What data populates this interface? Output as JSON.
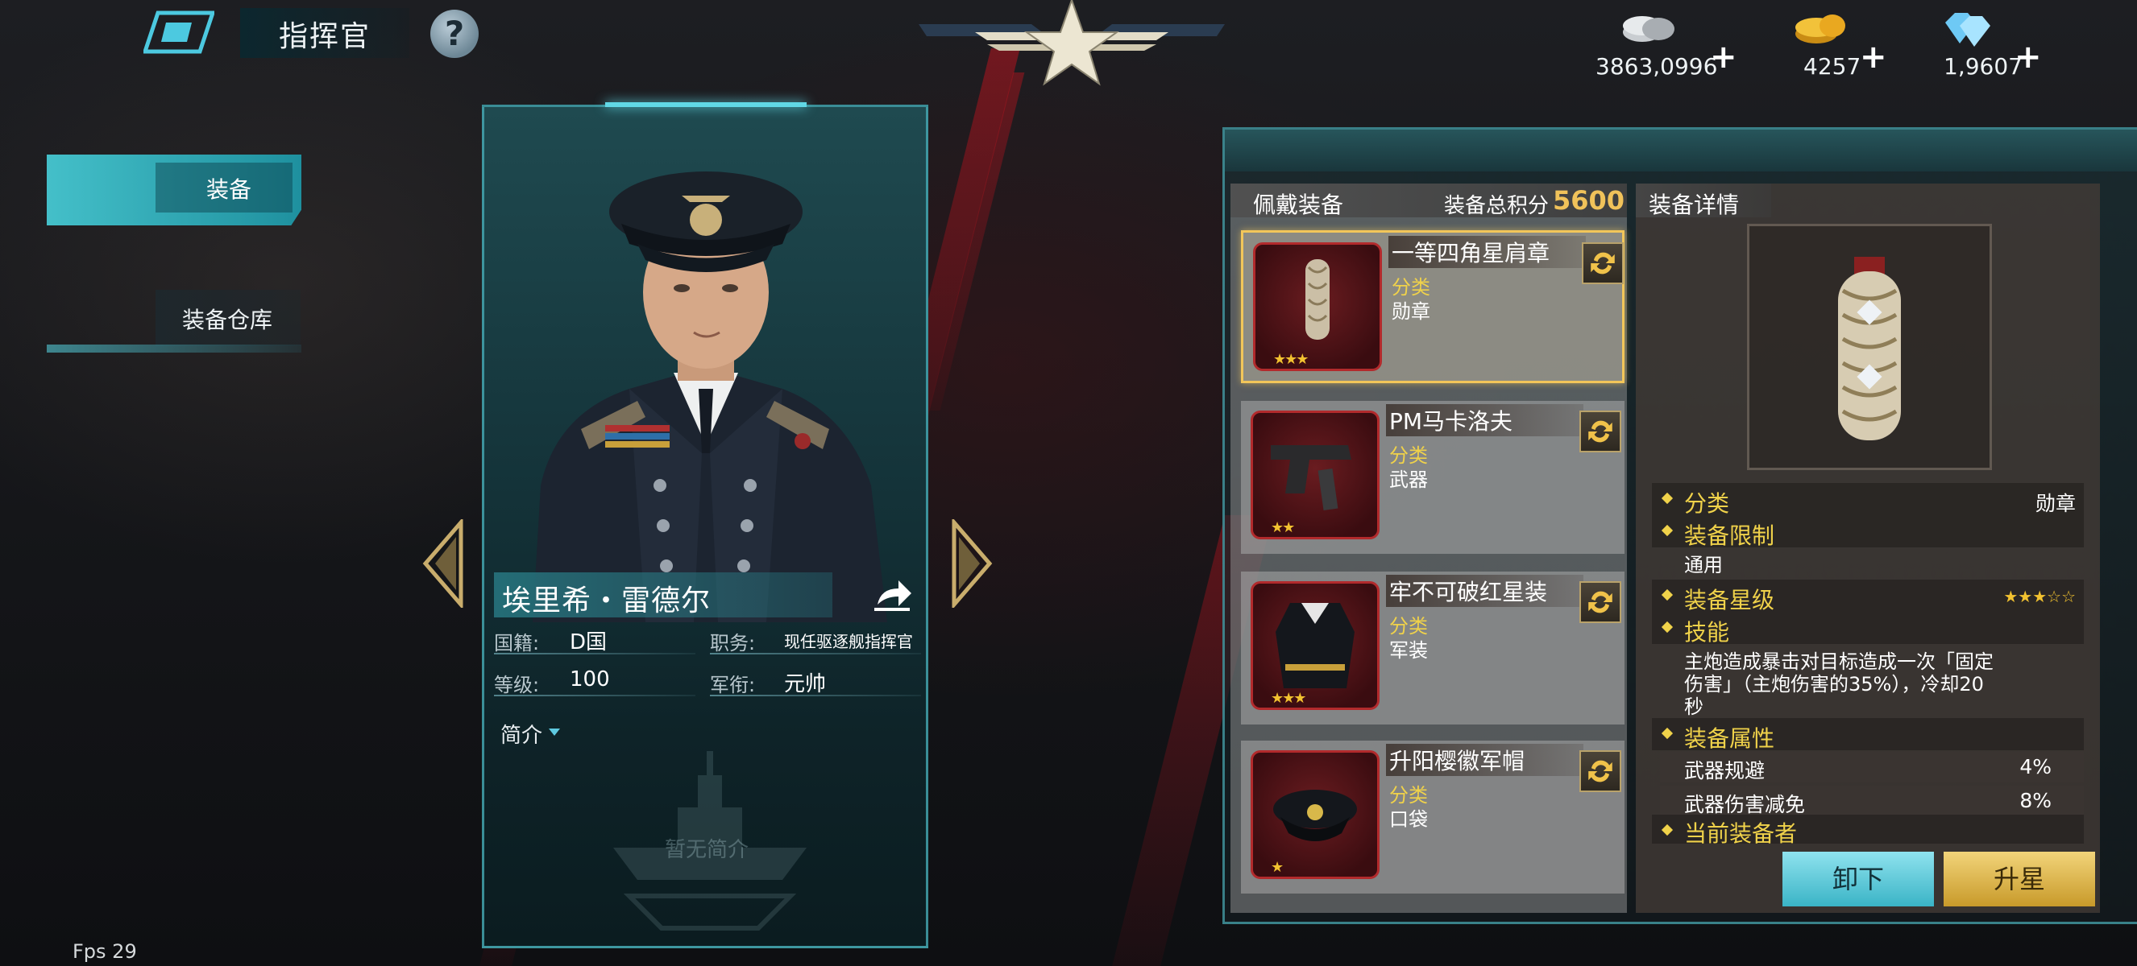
{
  "header": {
    "title": "指挥官",
    "help": "?"
  },
  "resources": [
    {
      "name": "silver-coins",
      "value": "3863,0996",
      "plus": "+"
    },
    {
      "name": "gold-coins",
      "value": "4257",
      "plus": "+"
    },
    {
      "name": "diamonds",
      "value": "1,9607",
      "plus": "+"
    }
  ],
  "menu": {
    "equip": "装备",
    "storage": "装备仓库"
  },
  "character": {
    "name": "埃里希・雷德尔",
    "nationality_label": "国籍:",
    "nationality": "D国",
    "position_label": "职务:",
    "position": "现任驱逐舰指挥官",
    "level_label": "等级:",
    "level": "100",
    "rank_label": "军衔:",
    "rank": "元帅",
    "intro_label": "简介",
    "no_intro": "暂无简介"
  },
  "equipment": {
    "header": "佩戴装备",
    "score_label": "装备总积分",
    "score": "5600",
    "items": [
      {
        "name": "一等四角星肩章",
        "cat_label": "分类",
        "category": "勋章",
        "stars": "★★★",
        "selected": true
      },
      {
        "name": "PM马卡洛夫",
        "cat_label": "分类",
        "category": "武器",
        "stars": "★★",
        "selected": false
      },
      {
        "name": "牢不可破红星装",
        "cat_label": "分类",
        "category": "军装",
        "stars": "★★★",
        "selected": false
      },
      {
        "name": "升阳樱徽军帽",
        "cat_label": "分类",
        "category": "口袋",
        "stars": "★",
        "selected": false
      }
    ]
  },
  "detail": {
    "header": "装备详情",
    "category_label": "分类",
    "category": "勋章",
    "restriction_label": "装备限制",
    "restriction": "通用",
    "star_label": "装备星级",
    "stars": "★★★☆☆",
    "skill_label": "技能",
    "skill_line1": "主炮造成暴击对目标造成一次「固定",
    "skill_line2": "伤害」（主炮伤害的35%），冷却20",
    "skill_line3": "秒",
    "attr_label": "装备属性",
    "attrs": [
      {
        "name": "武器规避",
        "value": "4%"
      },
      {
        "name": "武器伤害减免",
        "value": "8%"
      }
    ],
    "holder_label": "当前装备者",
    "unequip": "卸下",
    "upstar": "升星"
  },
  "fps": "Fps 29",
  "colors": {
    "accent": "#46c8d2",
    "gold": "#f0d24a",
    "red_frame": "#b22a2c"
  }
}
